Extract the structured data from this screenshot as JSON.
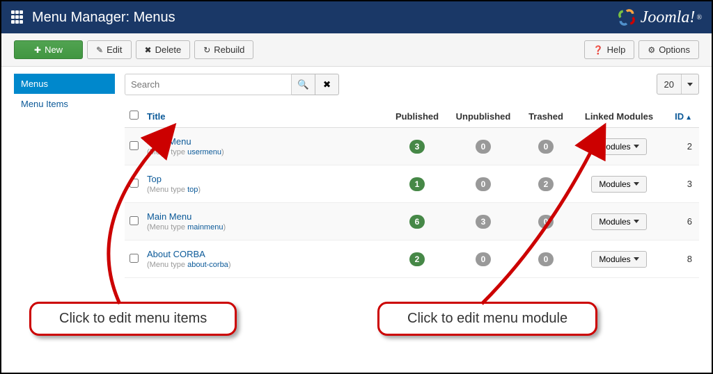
{
  "header": {
    "title": "Menu Manager: Menus",
    "brand": "Joomla!"
  },
  "toolbar": {
    "new": "New",
    "edit": "Edit",
    "delete": "Delete",
    "rebuild": "Rebuild",
    "help": "Help",
    "options": "Options"
  },
  "sidebar": {
    "items": [
      {
        "label": "Menus",
        "active": true
      },
      {
        "label": "Menu Items",
        "active": false
      }
    ]
  },
  "search": {
    "placeholder": "Search"
  },
  "limit": {
    "value": "20"
  },
  "columns": {
    "title": "Title",
    "published": "Published",
    "unpublished": "Unpublished",
    "trashed": "Trashed",
    "linked": "Linked Modules",
    "id": "ID"
  },
  "menuTypePrefix": "(Menu type ",
  "menuTypeSuffix": ")",
  "modulesBtn": "Modules",
  "rows": [
    {
      "title": "User Menu",
      "type": "usermenu",
      "published": "3",
      "unpublished": "0",
      "trashed": "0",
      "id": "2"
    },
    {
      "title": "Top",
      "type": "top",
      "published": "1",
      "unpublished": "0",
      "trashed": "2",
      "id": "3"
    },
    {
      "title": "Main Menu",
      "type": "mainmenu",
      "published": "6",
      "unpublished": "3",
      "trashed": "0",
      "id": "6"
    },
    {
      "title": "About CORBA",
      "type": "about-corba",
      "published": "2",
      "unpublished": "0",
      "trashed": "0",
      "id": "8"
    }
  ],
  "callouts": {
    "left": "Click to edit menu items",
    "right": "Click to edit menu module"
  }
}
